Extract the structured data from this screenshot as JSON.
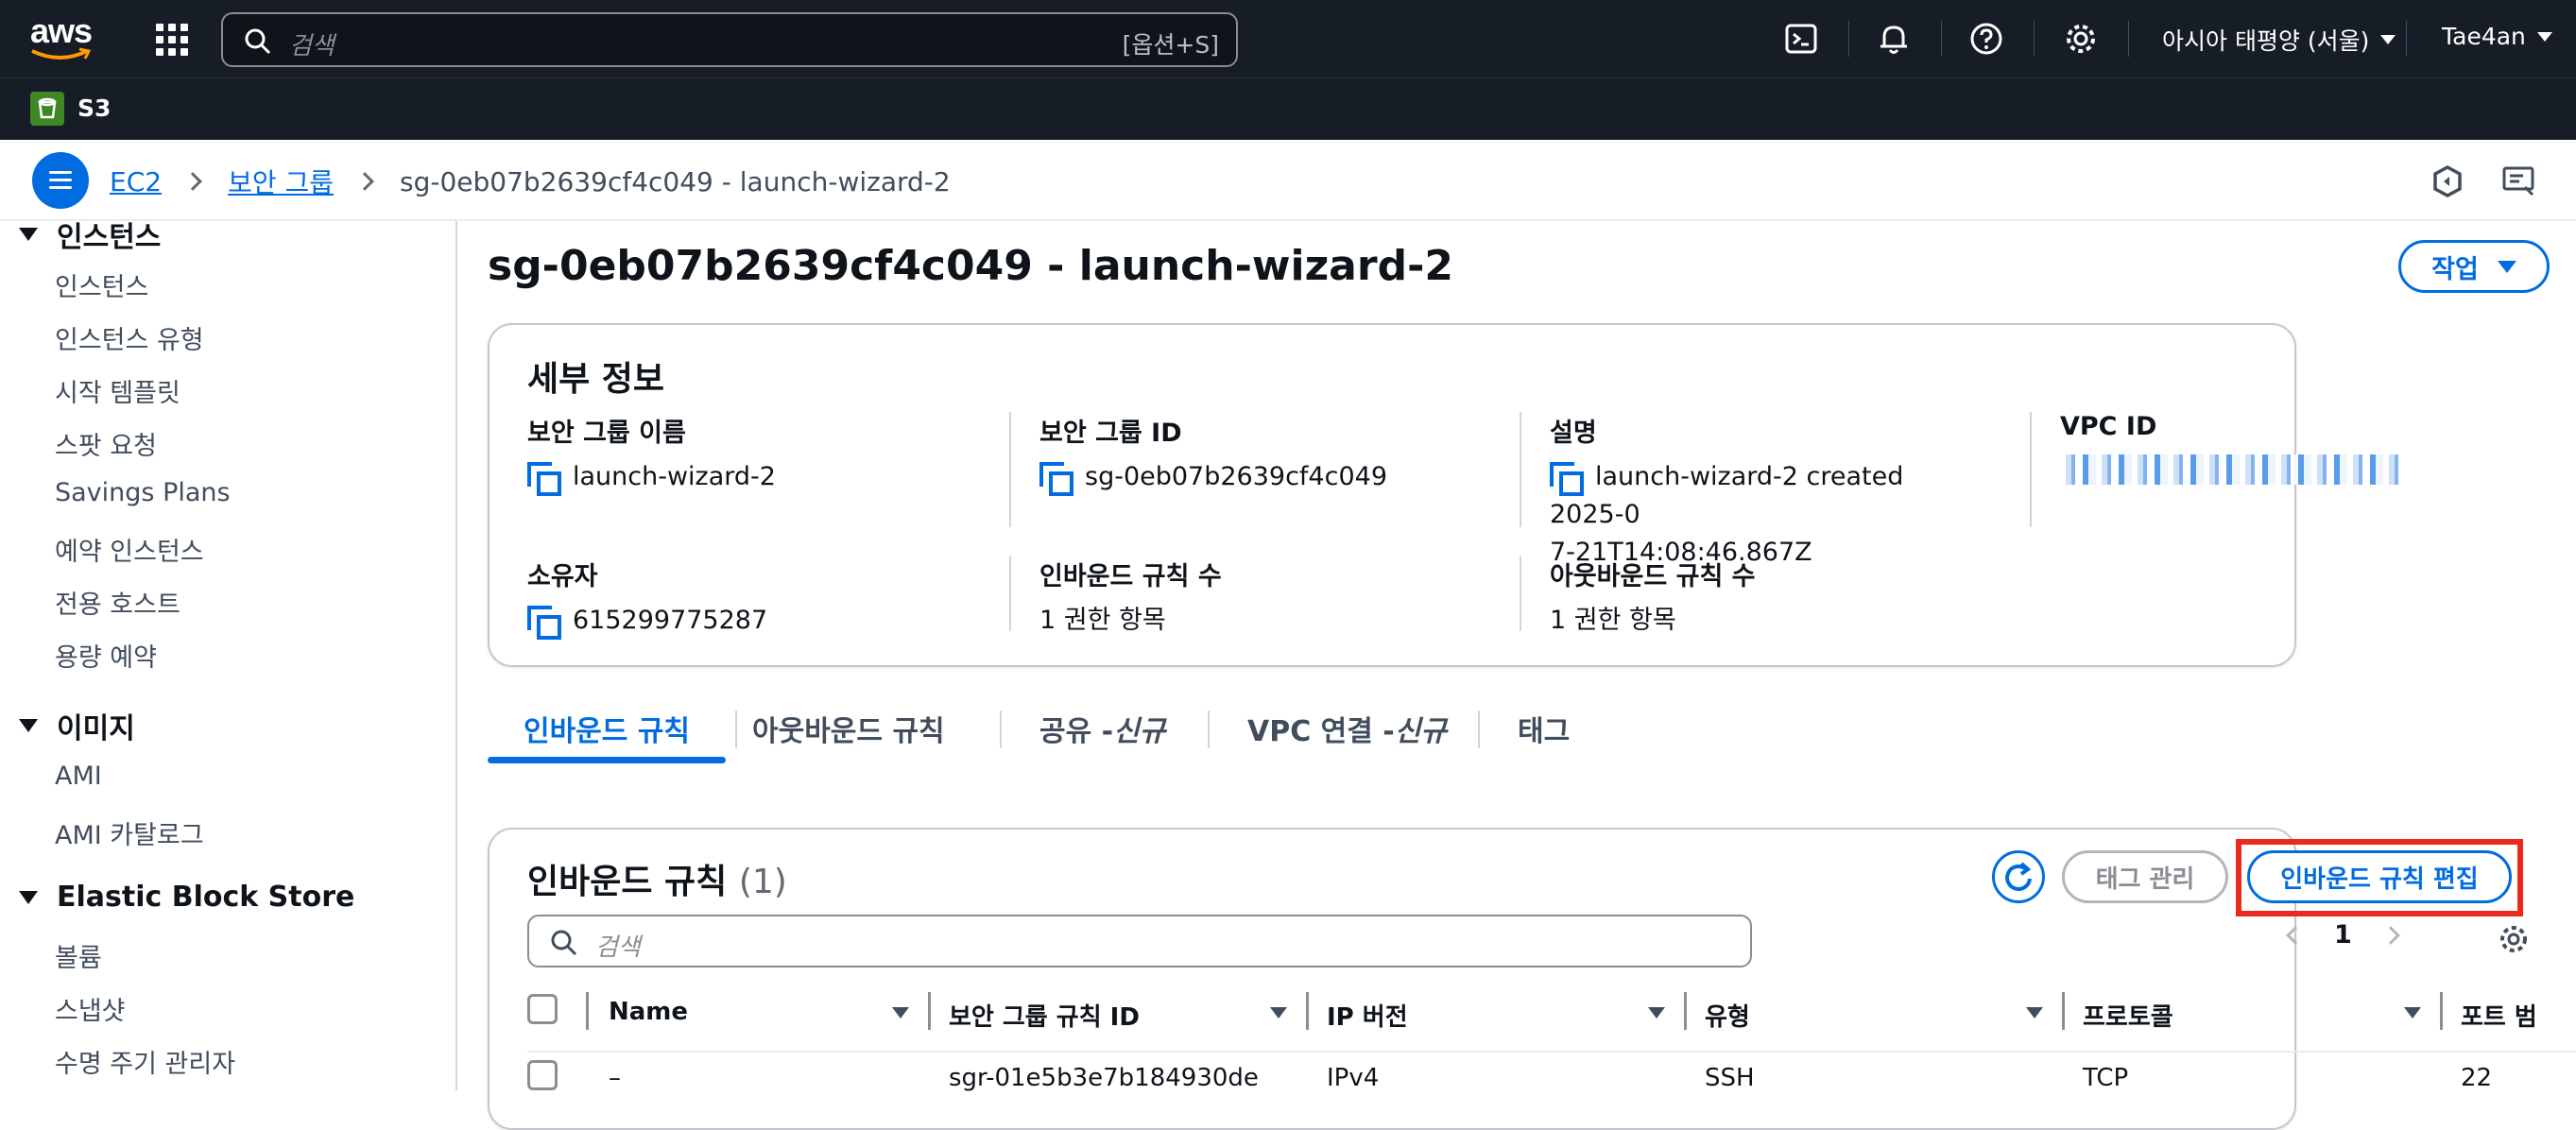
{
  "topnav": {
    "logo": "aws",
    "search_placeholder": "검색",
    "search_shortcut": "[옵션+S]",
    "region": "아시아 태평양 (서울)",
    "user": "Tae4an",
    "icons": [
      "apps-grid-icon",
      "cloudshell-icon",
      "bell-icon",
      "help-icon",
      "gear-icon"
    ]
  },
  "subnav": {
    "service": "S3"
  },
  "breadcrumb": {
    "items": [
      "EC2",
      "보안 그룹"
    ],
    "current": "sg-0eb07b2639cf4c049 - launch-wizard-2"
  },
  "sidebar": {
    "sections": [
      {
        "title": "인스턴스",
        "items": [
          "인스턴스",
          "인스턴스 유형",
          "시작 템플릿",
          "스팟 요청",
          "Savings Plans",
          "예약 인스턴스",
          "전용 호스트",
          "용량 예약"
        ]
      },
      {
        "title": "이미지",
        "items": [
          "AMI",
          "AMI 카탈로그"
        ]
      },
      {
        "title": "Elastic Block Store",
        "items": [
          "볼륨",
          "스냅샷",
          "수명 주기 관리자"
        ]
      }
    ]
  },
  "page": {
    "title": "sg-0eb07b2639cf4c049 - launch-wizard-2",
    "action_button": "작업"
  },
  "details": {
    "heading": "세부 정보",
    "fields": [
      {
        "label": "보안 그룹 이름",
        "value": "launch-wizard-2"
      },
      {
        "label": "보안 그룹 ID",
        "value": "sg-0eb07b2639cf4c049"
      },
      {
        "label": "설명",
        "value_line1": "launch-wizard-2 created 2025-0",
        "value_line2": "7-21T14:08:46.867Z"
      },
      {
        "label": "VPC ID",
        "value": ""
      },
      {
        "label": "소유자",
        "value": "615299775287"
      },
      {
        "label": "인바운드 규칙 수",
        "value": "1 권한 항목"
      },
      {
        "label": "아웃바운드 규칙 수",
        "value": "1 권한 항목"
      }
    ]
  },
  "tabs": [
    {
      "label": "인바운드 규칙",
      "active": true
    },
    {
      "label": "아웃바운드 규칙"
    },
    {
      "label": "공유 - ",
      "badge": "신규"
    },
    {
      "label": "VPC 연결 - ",
      "badge": "신규"
    },
    {
      "label": "태그"
    }
  ],
  "rules": {
    "title": "인바운드 규칙",
    "count": "(1)",
    "manage_tags": "태그 관리",
    "edit_button": "인바운드 규칙 편집",
    "search_placeholder": "검색",
    "page": "1",
    "columns": [
      "Name",
      "보안 그룹 규칙 ID",
      "IP 버전",
      "유형",
      "프로토콜",
      "포트 범"
    ],
    "rows": [
      {
        "name": "–",
        "rule_id": "sgr-01e5b3e7b184930de",
        "ip_version": "IPv4",
        "type": "SSH",
        "protocol": "TCP",
        "port": "22"
      }
    ]
  },
  "colors": {
    "nav_bg": "#161d26",
    "accent": "#006ce0",
    "highlight": "#ea2a1a",
    "s3_green": "#3f8624"
  }
}
